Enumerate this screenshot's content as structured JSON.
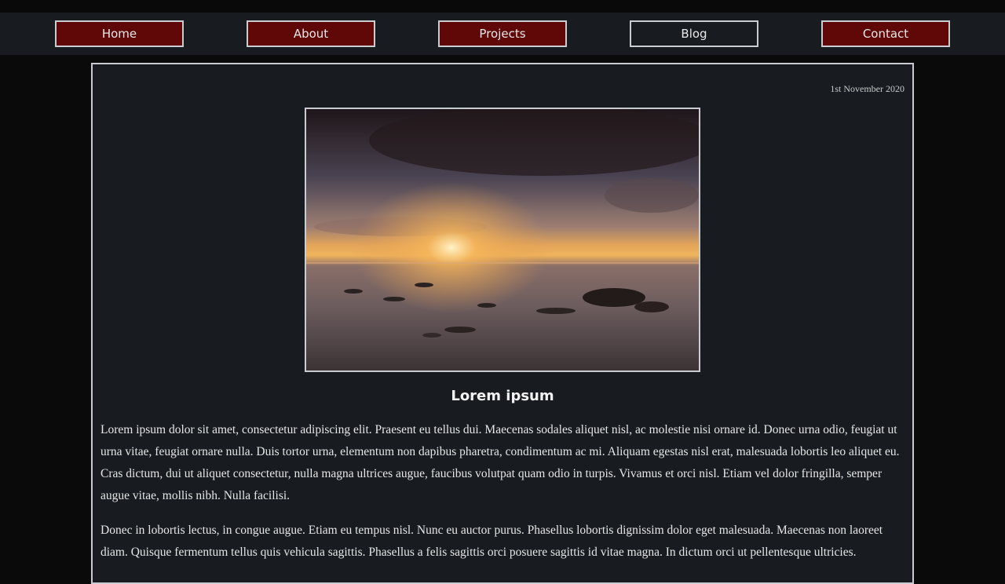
{
  "nav": {
    "items": [
      {
        "label": "Home",
        "active": false
      },
      {
        "label": "About",
        "active": false
      },
      {
        "label": "Projects",
        "active": false
      },
      {
        "label": "Blog",
        "active": true
      },
      {
        "label": "Contact",
        "active": false
      }
    ]
  },
  "post": {
    "date": "1st November 2020",
    "image_icon": "sunset-seascape-photo",
    "title": "Lorem ipsum",
    "paragraphs": [
      "Lorem ipsum dolor sit amet, consectetur adipiscing elit. Praesent eu tellus dui. Maecenas sodales aliquet nisl, ac molestie nisi ornare id. Donec urna odio, feugiat ut urna vitae, feugiat ornare nulla. Duis tortor urna, elementum non dapibus pharetra, condimentum ac mi. Aliquam egestas nisl erat, malesuada lobortis leo aliquet eu. Cras dictum, dui ut aliquet consectetur, nulla magna ultrices augue, faucibus volutpat quam odio in turpis. Vivamus et orci nisl. Etiam vel dolor fringilla, semper augue vitae, mollis nibh. Nulla facilisi.",
      "Donec in lobortis lectus, in congue augue. Etiam eu tempus nisl. Nunc eu auctor purus. Phasellus lobortis dignissim dolor eget malesuada. Maecenas non laoreet diam. Quisque fermentum tellus quis vehicula sagittis. Phasellus a felis sagittis orci posuere sagittis id vitae magna. In dictum orci ut pellentesque ultricies."
    ]
  },
  "colors": {
    "page_bg": "#0b0a0a",
    "panel_bg": "#181c20",
    "button_bg": "#600707",
    "border": "#c9ccd0"
  }
}
